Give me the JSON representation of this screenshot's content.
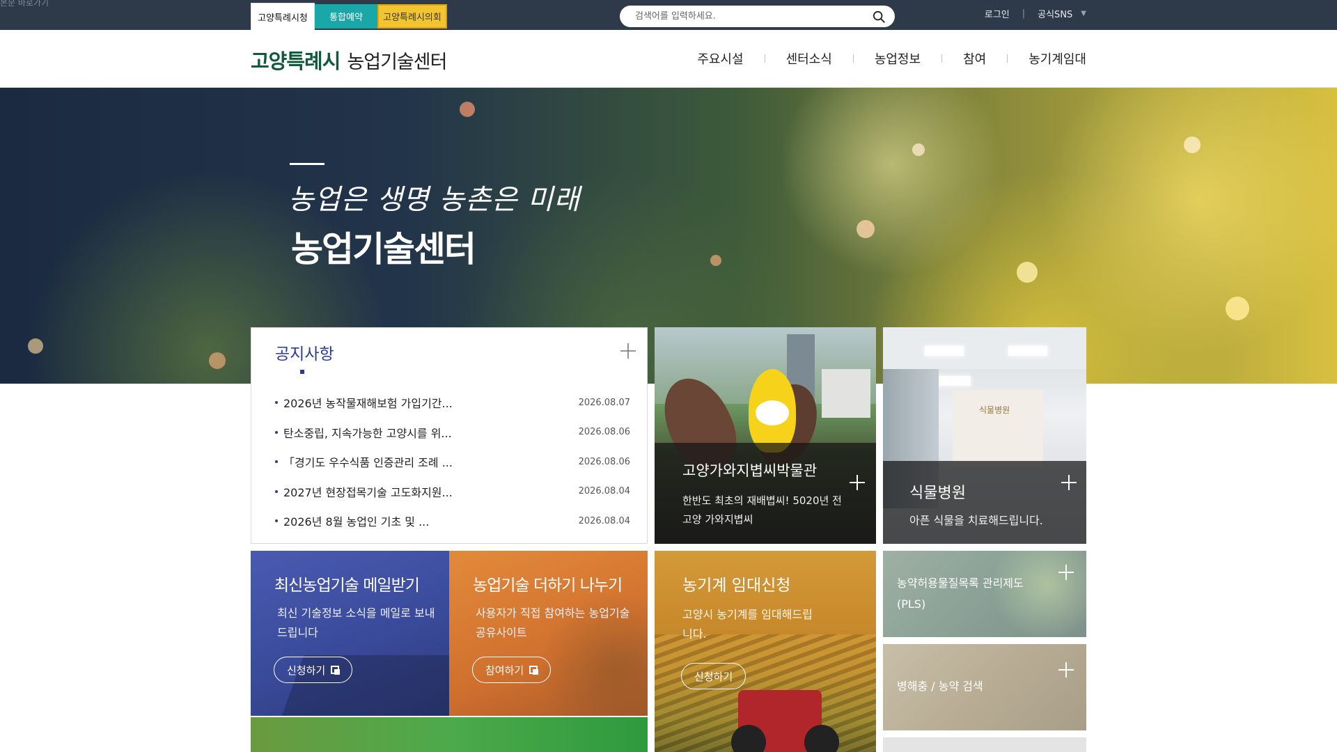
{
  "skip_link": "본문 바로가기",
  "site_tabs": [
    {
      "label": "고양특례시청"
    },
    {
      "label": "통합예약"
    },
    {
      "label": "고양특례시의회"
    }
  ],
  "search": {
    "placeholder": "검색어를 입력하세요."
  },
  "utils": {
    "login": "로그인",
    "sns": "공식SNS"
  },
  "header": {
    "logo_city": "고양특례시",
    "logo_center": "농업기술센터",
    "nav": [
      "주요시설",
      "센터소식",
      "농업정보",
      "참여",
      "농기계임대"
    ]
  },
  "hero": {
    "slogan": "농업은 생명 농촌은 미래",
    "title": "농업기술센터"
  },
  "notice": {
    "title": "공지사항",
    "items": [
      {
        "title": "2026년 농작물재해보험 가입기간...",
        "date": "2026.08.07"
      },
      {
        "title": "탄소중립, 지속가능한 고양시를 위...",
        "date": "2026.08.06"
      },
      {
        "title": "「경기도 우수식품 인증관리 조례 ...",
        "date": "2026.08.06"
      },
      {
        "title": "2027년 현장접목기술 고도화지원...",
        "date": "2026.08.04"
      },
      {
        "title": "2026년 8월 농업인 기초 및 ...",
        "date": "2026.08.04"
      }
    ]
  },
  "tiles": {
    "museum": {
      "title": "고양가와지볍씨박물관",
      "desc": "한반도 최초의 재배볍씨! 5020년 전 고양 가와지볍씨"
    },
    "hospital": {
      "title": "식물병원",
      "desc": "아픈 식물을 치료해드립니다.",
      "sign": "식물병원"
    },
    "mail": {
      "title": "최신농업기술 메일받기",
      "desc": "최신 기술정보 소식을 메일로 보내드립니다",
      "button": "신청하기"
    },
    "share": {
      "title": "농업기술 더하기 나누기",
      "desc": "사용자가 직접 참여하는 농업기술 공유사이트",
      "button": "참여하기"
    },
    "rental": {
      "title": "농기계 임대신청",
      "desc": "고양시 농기계를 임대해드립니다.",
      "button": "신청하기"
    },
    "pls": {
      "label": "농약허용물질목록 관리제도(PLS)"
    },
    "pest": {
      "label": "병해충 / 농약 검색"
    }
  },
  "colors": {
    "topbar": "#2e3a49",
    "brand_green": "#0f5a3a",
    "notice_blue": "#2b3a9a",
    "tab_teal": "#19a7a8",
    "tab_yellow": "#f3c431"
  },
  "icons": {
    "search": "search-icon",
    "plus": "plus-icon",
    "doc": "document-icon",
    "caret": "caret-down-icon"
  }
}
